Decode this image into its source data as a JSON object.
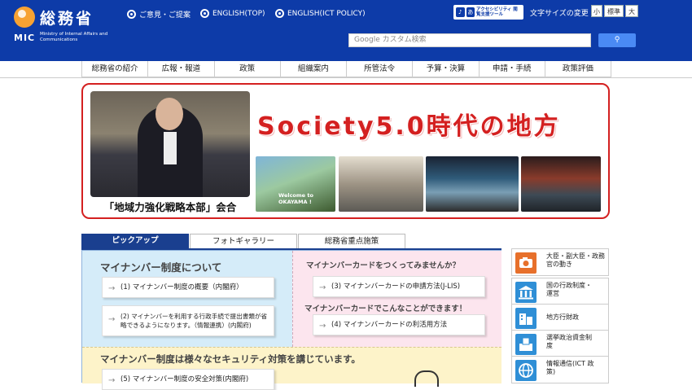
{
  "header": {
    "logo_jp": "総務省",
    "logo_mic": "MIC",
    "logo_en": "Ministry of Internal Affairs and Communications",
    "links": [
      {
        "label": "ご意見・ご提案"
      },
      {
        "label": "ENGLISH(TOP)"
      },
      {
        "label": "ENGLISH(ICT POLICY)"
      }
    ],
    "accessibility_label": "アクセシビリティ 閲覧支援ツール",
    "font_size_label": "文字サイズの変更",
    "font_sizes": [
      "小",
      "標準",
      "大"
    ],
    "search_placeholder": "Google カスタム検索",
    "search_button_icon": "search-icon",
    "brand_color": "#0d3ba8"
  },
  "nav": {
    "items": [
      "総務省の紹介",
      "広報・報道",
      "政策",
      "組織案内",
      "所管法令",
      "予算・決算",
      "申請・手続",
      "政策評価"
    ]
  },
  "banner": {
    "title": "Society5.0時代の地方",
    "caption": "「地域力強化戦略本部」会合",
    "thumb_text": "Welcome to OKAYAMA !",
    "accent_color": "#d42020"
  },
  "pickup": {
    "tabs": [
      "ピックアップ",
      "フォトギャラリー",
      "総務省重点施策"
    ],
    "left": {
      "heading": "マイナンバー制度について",
      "items": [
        "(1) マイナンバー制度の概要（内閣府）",
        "(2) マイナンバーを利用する行政手続で提出書類が省略できるようになります。（情報連携）(内閣府)"
      ]
    },
    "right": {
      "heading": "マイナンバーカードをつくってみませんか？",
      "item1": "(3) マイナンバーカードの申請方法(J-LIS)",
      "heading2": "マイナンバーカードでこんなことができます！",
      "item2": "(4) マイナンバーカードの利活用方法"
    },
    "bottom": {
      "heading": "マイナンバー制度は様々なセキュリティ対策を講じています。",
      "item": "(5) マイナンバー制度の安全対策(内閣府)"
    }
  },
  "side_menu": [
    {
      "label": "大臣・副大臣・政務官の動き",
      "icon": "camera-icon",
      "color": "#e7702b"
    },
    {
      "label": "国の行政制度・運営",
      "icon": "government-building-icon",
      "color": "#2f8fd6"
    },
    {
      "label": "地方行財政",
      "icon": "city-building-icon",
      "color": "#2f8fd6"
    },
    {
      "label": "選挙政治資金制度",
      "icon": "ballot-box-icon",
      "color": "#2f8fd6"
    },
    {
      "label": "情報通信(ICT 政策)",
      "icon": "globe-icon",
      "color": "#2f8fd6"
    }
  ]
}
